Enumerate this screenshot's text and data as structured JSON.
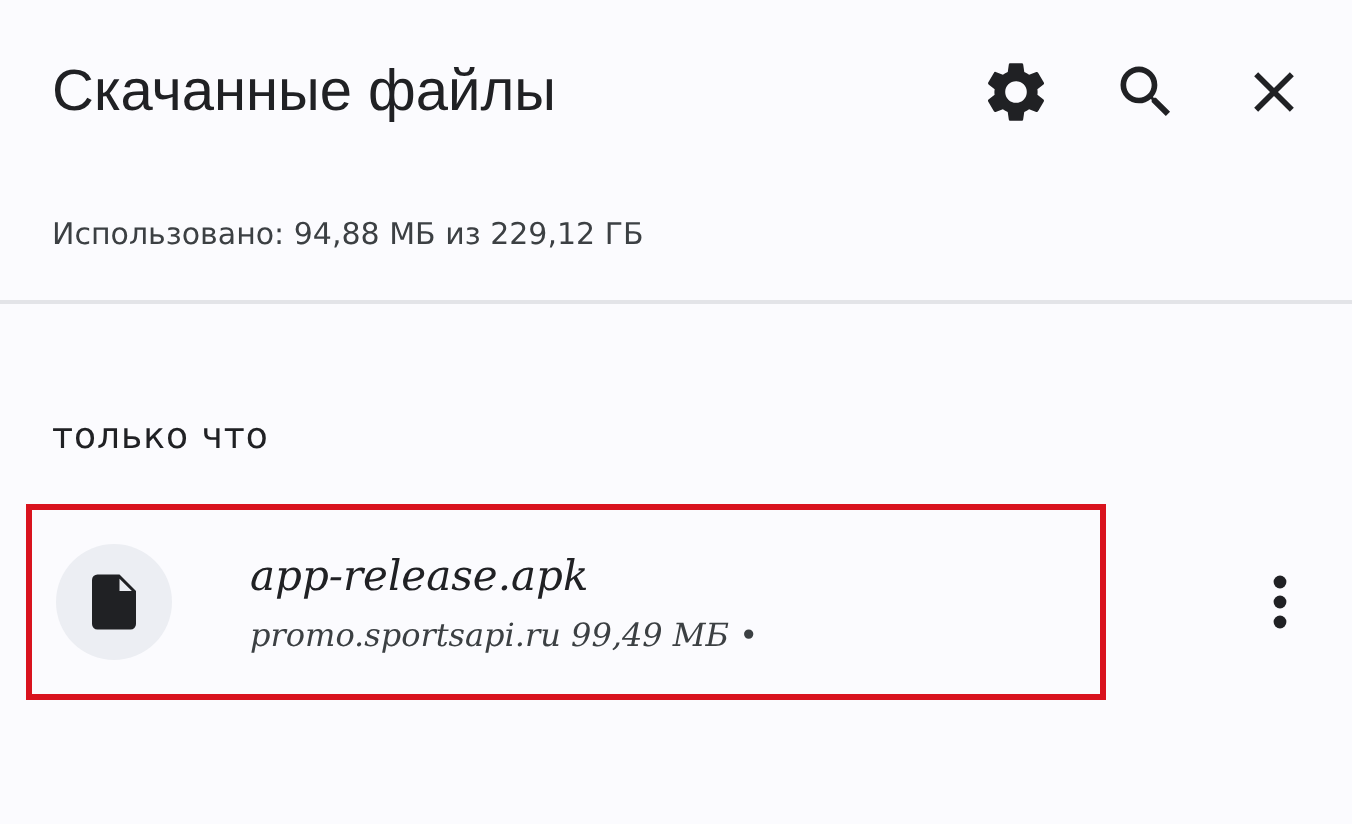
{
  "header": {
    "title": "Скачанные файлы"
  },
  "storage": "Использовано: 94,88 МБ из 229,12 ГБ",
  "sections": [
    {
      "heading": "только что",
      "items": [
        {
          "name": "app-release.apk",
          "details": "promo.sportsapi.ru 99,49 МБ •",
          "highlighted": true
        }
      ]
    }
  ]
}
